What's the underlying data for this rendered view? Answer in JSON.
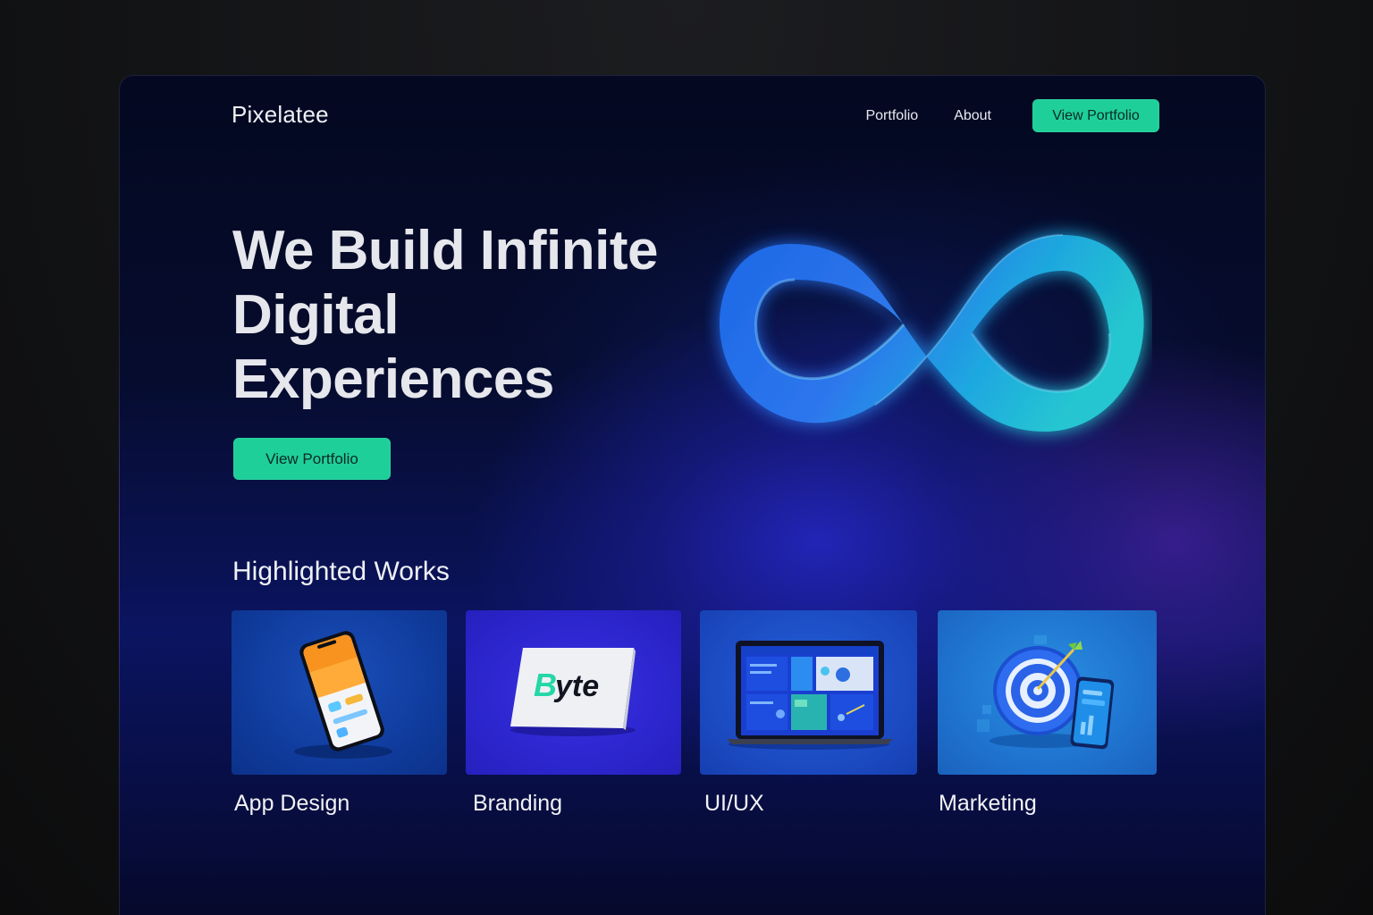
{
  "brand": {
    "name": "Pixelatee"
  },
  "nav": {
    "links": [
      "Portfolio",
      "About"
    ],
    "cta": "View Portfolio"
  },
  "hero": {
    "title_lines": [
      "We Build Infinite",
      "Digital",
      "Experiences"
    ],
    "cta": "View Portfolio",
    "illustration": "infinity-icon"
  },
  "works": {
    "title": "Highlighted Works",
    "items": [
      {
        "label": "App Design",
        "icon": "smartphone-icon"
      },
      {
        "label": "Branding",
        "icon": "brand-card-icon",
        "logo_text": "Byte"
      },
      {
        "label": "UI/UX",
        "icon": "laptop-icon"
      },
      {
        "label": "Marketing",
        "icon": "target-icon"
      }
    ]
  },
  "colors": {
    "accent": "#1fcf9a",
    "background_top": "#040820",
    "background_glow": "#2628c8"
  }
}
